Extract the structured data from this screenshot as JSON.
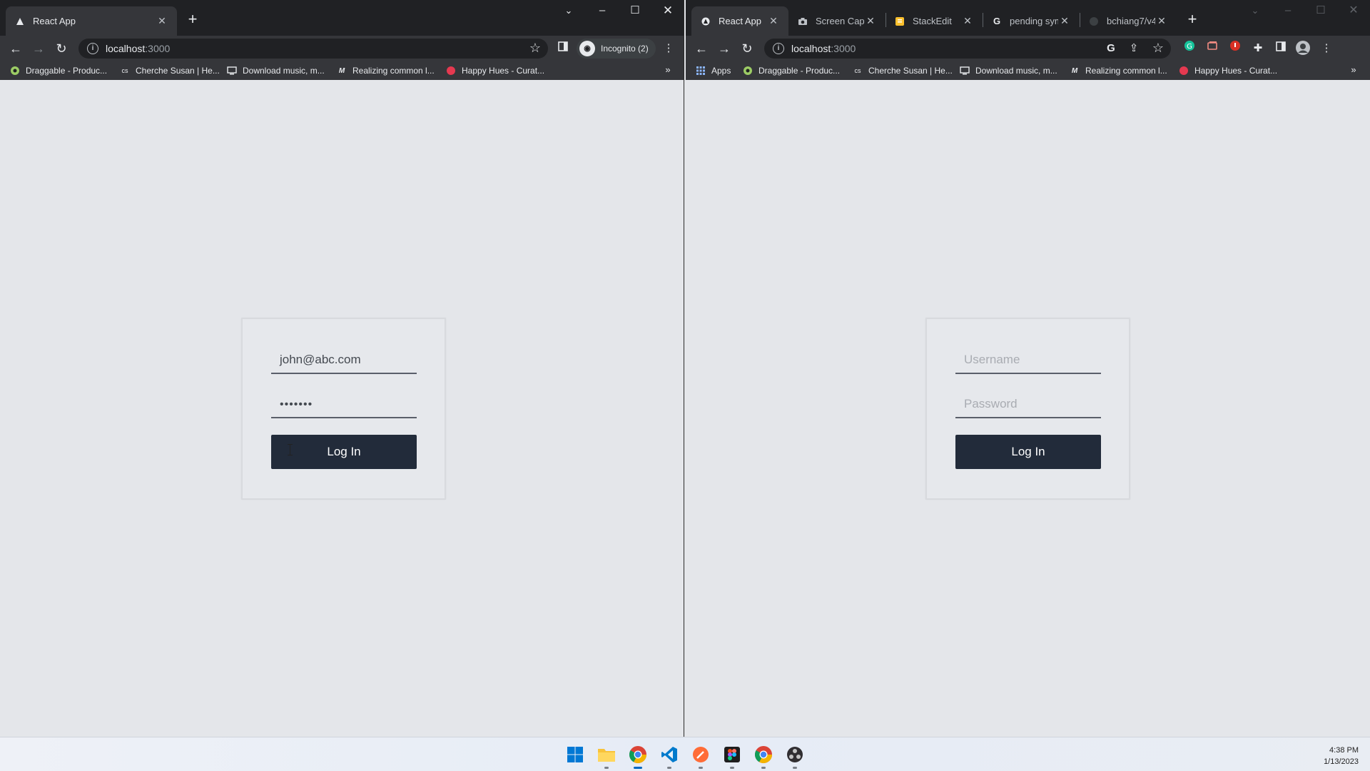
{
  "left_window": {
    "tabs": [
      {
        "label": "React App",
        "favicon": "react-app-icon"
      }
    ],
    "address": {
      "host": "localhost",
      "port": ":3000"
    },
    "incognito_label": "Incognito (2)",
    "bookmarks": [
      {
        "label": "Draggable - Produc...",
        "icon": "draggable-icon"
      },
      {
        "label": "Cherche Susan | He...",
        "icon": "cs-icon"
      },
      {
        "label": "Download music, m...",
        "icon": "monitor-icon"
      },
      {
        "label": "Realizing common l...",
        "icon": "medium-icon"
      },
      {
        "label": "Happy Hues - Curat...",
        "icon": "happy-hues-icon"
      }
    ],
    "login": {
      "email_value": "john@abc.com",
      "password_value": "•••••••",
      "button_label": "Log In"
    }
  },
  "right_window": {
    "tabs": [
      {
        "label": "React App",
        "favicon": "react-app-icon"
      },
      {
        "label": "Screen Captu",
        "favicon": "camera-icon"
      },
      {
        "label": "StackEdit",
        "favicon": "stackedit-icon"
      },
      {
        "label": "pending sym",
        "favicon": "google-icon"
      },
      {
        "label": "bchiang7/v4",
        "favicon": "github-icon"
      }
    ],
    "address": {
      "host": "localhost",
      "port": ":3000"
    },
    "bookmarks": [
      {
        "label": "Apps",
        "icon": "apps-grid-icon"
      },
      {
        "label": "Draggable - Produc...",
        "icon": "draggable-icon"
      },
      {
        "label": "Cherche Susan | He...",
        "icon": "cs-icon"
      },
      {
        "label": "Download music, m...",
        "icon": "monitor-icon"
      },
      {
        "label": "Realizing common l...",
        "icon": "medium-icon"
      },
      {
        "label": "Happy Hues - Curat...",
        "icon": "happy-hues-icon"
      }
    ],
    "login": {
      "username_placeholder": "Username",
      "password_placeholder": "Password",
      "button_label": "Log In"
    }
  },
  "taskbar": {
    "apps": [
      "windows-start-icon",
      "file-explorer-icon",
      "chrome-icon",
      "vscode-icon",
      "postman-icon",
      "figma-icon",
      "chrome-icon",
      "obs-icon"
    ],
    "time": "4:38 PM",
    "date": "1/13/2023"
  },
  "colors": {
    "page_background": "#e4e6ea",
    "button_background": "#222b3a",
    "browser_frame": "#202124"
  }
}
